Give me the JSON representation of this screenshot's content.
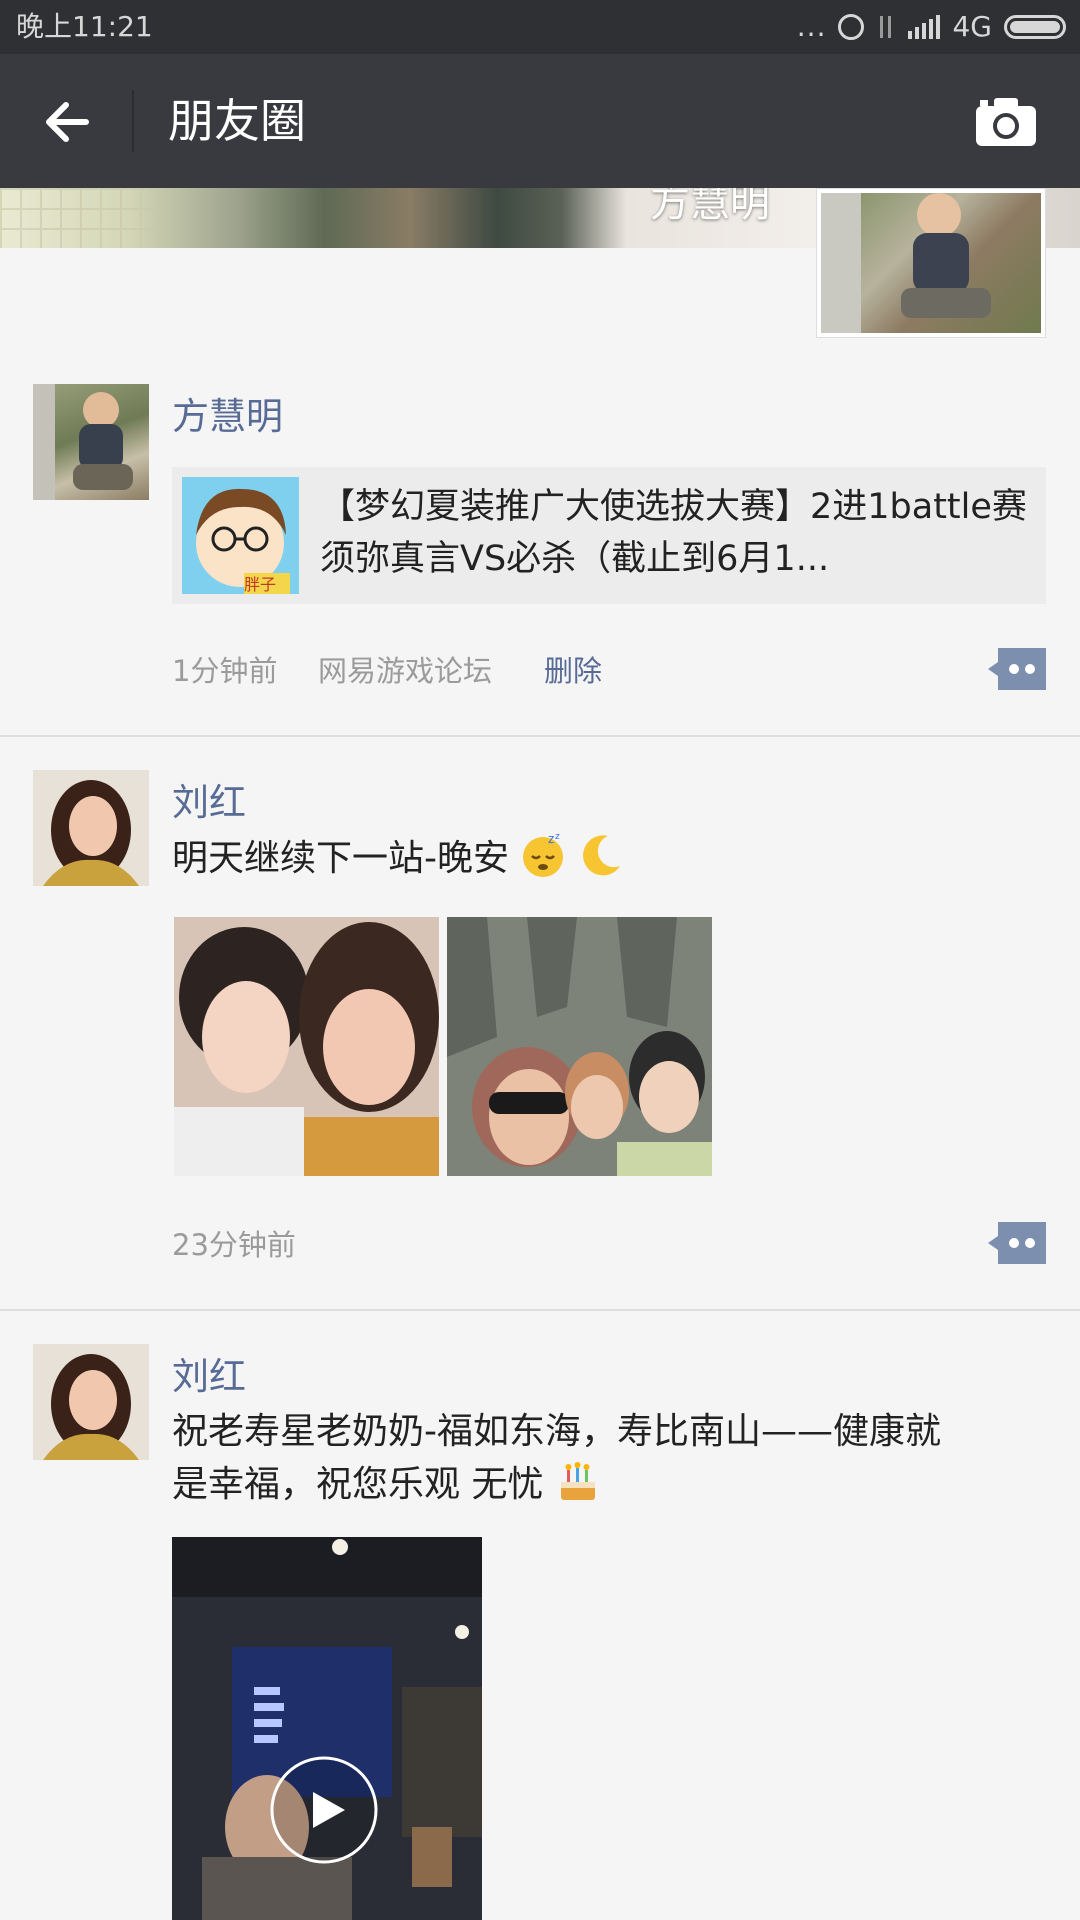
{
  "status_bar": {
    "time": "晚上11:21",
    "dots": "...",
    "network": "4G",
    "battery_level": 1.0
  },
  "header": {
    "title": "朋友圈",
    "back_icon": "arrow-left-icon",
    "camera_icon": "camera-icon"
  },
  "cover": {
    "owner_name": "方慧明"
  },
  "posts": [
    {
      "author": "方慧明",
      "share_title": "【梦幻夏装推广大使选拔大赛】2进1battle赛 须弥真言VS必杀（截止到6月1...",
      "thumb_label": "胖子",
      "time": "1分钟前",
      "source": "网易游戏论坛",
      "delete_label": "删除"
    },
    {
      "author": "刘红",
      "text": "明天继续下一站-晚安",
      "emojis": [
        "sleepy-face-icon",
        "crescent-moon-icon"
      ],
      "time": "23分钟前"
    },
    {
      "author": "刘红",
      "text_line1": "祝老寿星老奶奶-福如东海，寿比南山——健康就",
      "text_line2": "是幸福，祝您乐观 无忧",
      "emojis": [
        "birthday-cake-icon"
      ]
    }
  ],
  "colors": {
    "link": "#576b95",
    "header_bg": "#393a3f",
    "status_bg": "#2f3034",
    "page_bg": "#f5f5f5"
  }
}
